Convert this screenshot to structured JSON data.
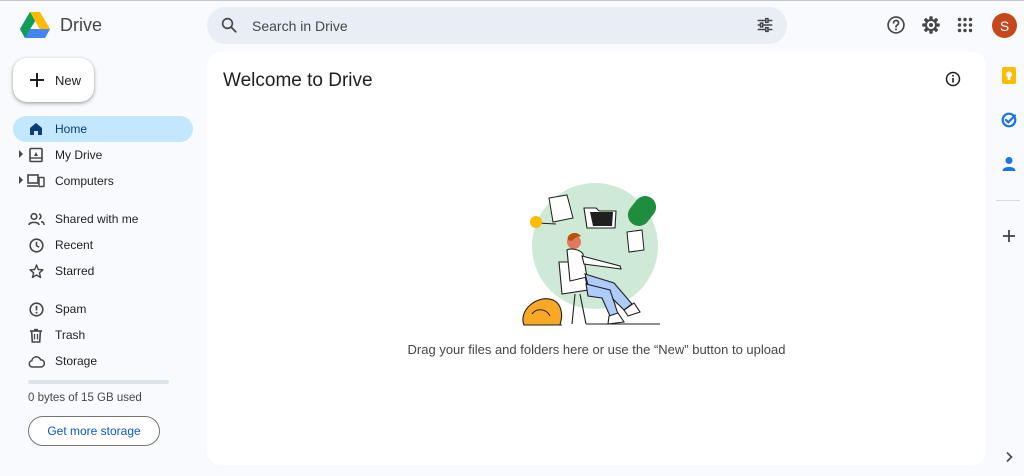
{
  "app": {
    "name": "Drive"
  },
  "search": {
    "placeholder": "Search in Drive"
  },
  "header": {
    "avatar_letter": "S",
    "avatar_color": "#c5481d"
  },
  "sidebar": {
    "new_label": "New",
    "items": [
      {
        "label": "Home",
        "icon": "home-icon",
        "active": true
      },
      {
        "label": "My Drive",
        "icon": "my-drive-icon",
        "expandable": true
      },
      {
        "label": "Computers",
        "icon": "computers-icon",
        "expandable": true
      },
      {
        "label": "Shared with me",
        "icon": "people-icon"
      },
      {
        "label": "Recent",
        "icon": "clock-icon"
      },
      {
        "label": "Starred",
        "icon": "star-icon"
      },
      {
        "label": "Spam",
        "icon": "spam-icon"
      },
      {
        "label": "Trash",
        "icon": "trash-icon"
      },
      {
        "label": "Storage",
        "icon": "cloud-icon"
      }
    ],
    "storage_text": "0 bytes of 15 GB used",
    "storage_button": "Get more storage"
  },
  "main": {
    "title": "Welcome to Drive",
    "empty_text": "Drag your files and folders here or use the “New” button to upload"
  },
  "colors": {
    "accent": "#0b57d0",
    "active_bg": "#c2e7ff",
    "page_bg": "#f8fafd"
  }
}
